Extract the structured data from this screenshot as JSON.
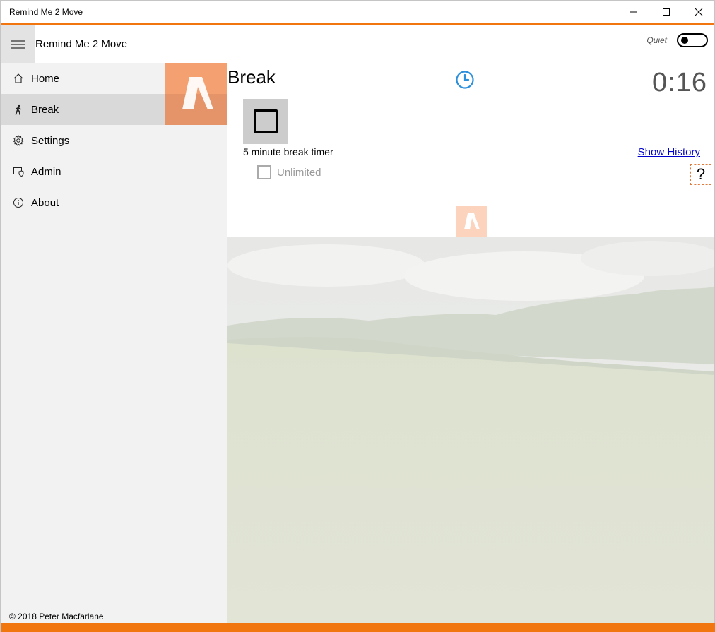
{
  "window": {
    "title": "Remind Me 2 Move",
    "accent_color": "#f2760f"
  },
  "sidebar": {
    "app_name": "Remind Me 2 Move",
    "items": [
      {
        "label": "Home",
        "icon": "home-icon",
        "selected": false
      },
      {
        "label": "Break",
        "icon": "walking-person-icon",
        "selected": true
      },
      {
        "label": "Settings",
        "icon": "gear-icon",
        "selected": false
      },
      {
        "label": "Admin",
        "icon": "admin-shield-icon",
        "selected": false
      },
      {
        "label": "About",
        "icon": "info-icon",
        "selected": false
      }
    ],
    "copyright": "© 2018 Peter Macfarlane"
  },
  "header": {
    "quiet_label": "Quiet",
    "quiet_on": false
  },
  "main": {
    "page_title": "Break",
    "timer_value": "0:16",
    "timer_description": "5 minute break timer",
    "unlimited_label": "Unlimited",
    "unlimited_checked": false,
    "show_history_label": "Show History",
    "help_label": "?"
  }
}
